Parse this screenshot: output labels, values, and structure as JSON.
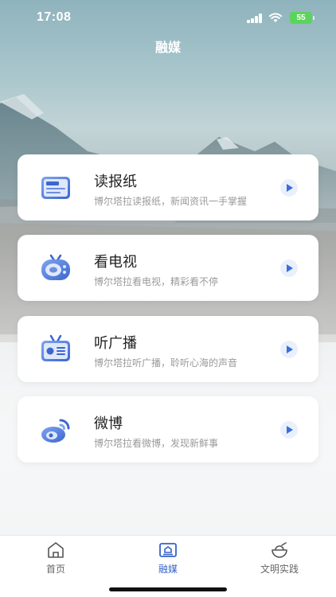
{
  "status_bar": {
    "time": "17:08",
    "battery": "55"
  },
  "header": {
    "title": "融媒"
  },
  "cards": [
    {
      "title": "读报纸",
      "desc": "博尔塔拉读报纸，新闻资讯一手掌握",
      "icon": "newspaper-icon"
    },
    {
      "title": "看电视",
      "desc": "博尔塔拉看电视，精彩看不停",
      "icon": "tv-icon"
    },
    {
      "title": "听广播",
      "desc": "博尔塔拉听广播，聆听心海的声音",
      "icon": "radio-icon"
    },
    {
      "title": "微博",
      "desc": "博尔塔拉看微博，发现新鲜事",
      "icon": "weibo-icon"
    }
  ],
  "tabbar": {
    "items": [
      {
        "label": "首页",
        "icon": "home-icon",
        "active": false
      },
      {
        "label": "融媒",
        "icon": "media-icon",
        "active": true
      },
      {
        "label": "文明实践",
        "icon": "civilization-icon",
        "active": false
      }
    ]
  },
  "colors": {
    "accent": "#3563c9",
    "play_bg": "#eaf0fb",
    "battery": "#5bd45b"
  }
}
